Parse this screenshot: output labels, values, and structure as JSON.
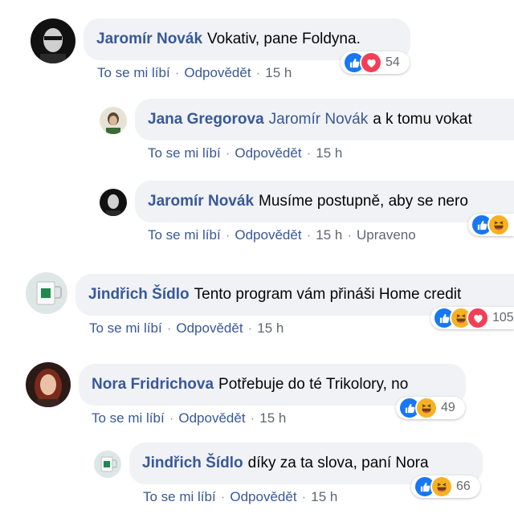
{
  "labels": {
    "like": "To se mi líbí",
    "reply": "Odpovědět",
    "separator": "·"
  },
  "comments": [
    {
      "author": "Jaromír Novák",
      "mention": "",
      "text": "Vokativ, pane Foldyna.",
      "time": "15 h",
      "edited": "",
      "reactions": [
        "like-icon",
        "love-icon"
      ],
      "count": "54",
      "avatar": "dark-portrait"
    },
    {
      "author": "Jana Gregorova",
      "mention": "Jaromír Novák",
      "text": "a k tomu vokat",
      "time": "15 h",
      "edited": "",
      "reactions": [],
      "count": "",
      "avatar": "light-portrait"
    },
    {
      "author": "Jaromír Novák",
      "mention": "",
      "text": "Musíme postupně, aby se nero",
      "time": "15 h",
      "edited": "Upraveno",
      "reactions": [
        "like-icon",
        "haha-icon"
      ],
      "count": "",
      "avatar": "dark-portrait"
    },
    {
      "author": "Jindřich Šídlo",
      "mention": "",
      "text": "Tento program vám přináši Home credit",
      "time": "15 h",
      "edited": "",
      "reactions": [
        "like-icon",
        "haha-icon",
        "love-icon"
      ],
      "count": "105",
      "avatar": "mug-logo"
    },
    {
      "author": "Nora Fridrichova",
      "mention": "",
      "text": "Potřebuje do té Trikolory, no",
      "time": "15 h",
      "edited": "",
      "reactions": [
        "like-icon",
        "haha-icon"
      ],
      "count": "49",
      "avatar": "red-hair-portrait"
    },
    {
      "author": "Jindřich Šídlo",
      "mention": "",
      "text": "díky za ta slova, paní Nora",
      "time": "15 h",
      "edited": "",
      "reactions": [
        "like-icon",
        "haha-icon"
      ],
      "count": "66",
      "avatar": "mug-logo"
    }
  ],
  "colors": {
    "link": "#385898",
    "bubble": "#f0f2f5",
    "like": "#1877f2",
    "love": "#f33e58",
    "haha": "#f7b125",
    "muted": "#65676b"
  }
}
